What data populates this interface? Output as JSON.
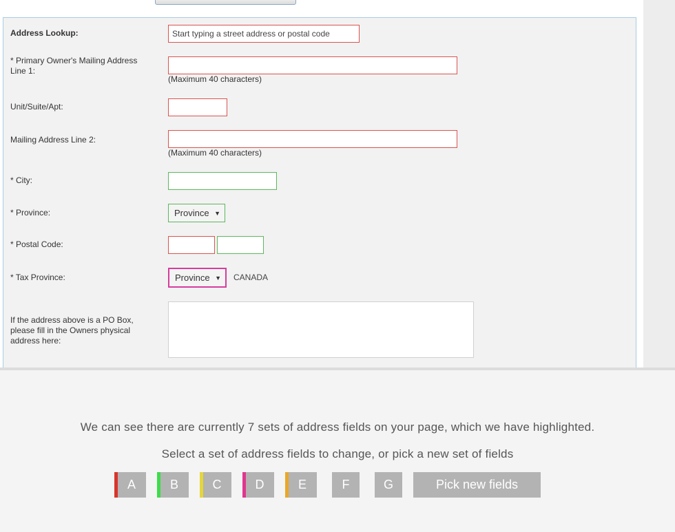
{
  "form": {
    "address_lookup_label": "Address Lookup:",
    "address_lookup_placeholder": "Start typing a street address or postal code",
    "line1_label": "* Primary Owner's Mailing Address Line 1:",
    "line1_hint": "(Maximum 40 characters)",
    "unit_label": "Unit/Suite/Apt:",
    "line2_label": "Mailing Address Line 2:",
    "line2_hint": "(Maximum 40 characters)",
    "city_label": "* City:",
    "province_label": "* Province:",
    "province_value": "Province",
    "postal_label": "* Postal Code:",
    "tax_province_label": "* Tax Province:",
    "tax_province_value": "Province",
    "country": "CANADA",
    "po_box_label": "If the address above is a PO Box, please fill in the Owners physical address here:"
  },
  "overlay": {
    "message": "We can see there are currently 7 sets of address fields on your page, which we have highlighted.",
    "instruction": "Select a set of address fields to change, or pick a new set of fields",
    "sets": [
      {
        "label": "A",
        "color": "#d9342b"
      },
      {
        "label": "B",
        "color": "#3ddc4a"
      },
      {
        "label": "C",
        "color": "#e5d63a"
      },
      {
        "label": "D",
        "color": "#e0368e"
      },
      {
        "label": "E",
        "color": "#e8a82a"
      },
      {
        "label": "F",
        "color": ""
      },
      {
        "label": "G",
        "color": ""
      }
    ],
    "pick_new_label": "Pick new fields"
  },
  "colors": {
    "field_red": "#d9534f",
    "field_green": "#5cb85c",
    "field_pink": "#d63c9d",
    "button_gray": "#b3b3b3"
  }
}
